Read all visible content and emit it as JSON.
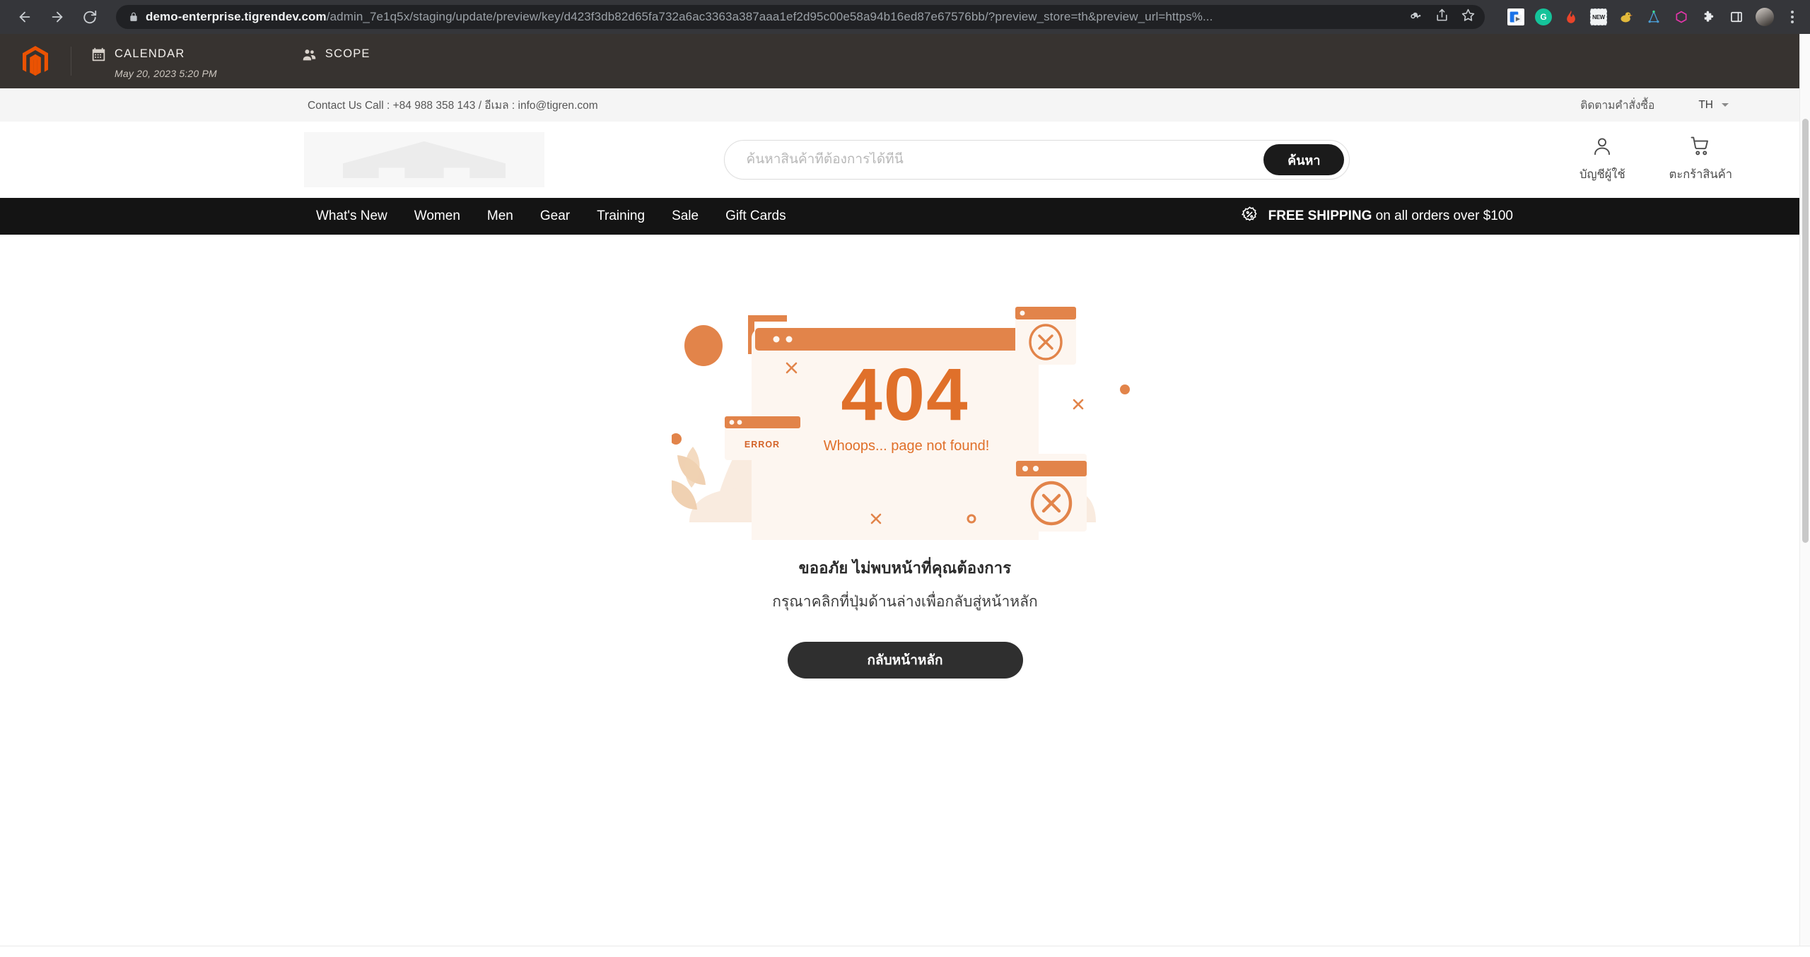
{
  "browser": {
    "back_label": "Back",
    "forward_label": "Forward",
    "reload_label": "Reload",
    "url_domain": "demo-enterprise.tigrendev.com",
    "url_path": "/admin_7e1q5x/staging/update/preview/key/d423f3db82d65fa732a6ac3363a387aaa1ef2d95c00e58a94b16ed87e67576bb/?preview_store=th&preview_url=https%...",
    "icons": {
      "lock": "lock-icon",
      "password_key": "key-icon",
      "share": "share-icon",
      "bookmark": "star-icon",
      "kebab": "more-vertical-icon"
    },
    "extensions": [
      {
        "name": "google-docs-extension",
        "glyph": "G",
        "color": "#1a73e8"
      },
      {
        "name": "grammarly-extension",
        "glyph": "G",
        "color": "#15c39a"
      },
      {
        "name": "fire-extension",
        "glyph": "▲",
        "color": "#e8442a"
      },
      {
        "name": "new-badge-extension",
        "glyph": "NEW",
        "color": "#f3f3f3"
      },
      {
        "name": "duck-extension",
        "glyph": "●",
        "color": "#e2b93b"
      },
      {
        "name": "network-extension",
        "glyph": "✳",
        "color": "#4b9cd3"
      },
      {
        "name": "graphql-extension",
        "glyph": "⬡",
        "color": "#e535ab"
      },
      {
        "name": "puzzle-extension",
        "glyph": "❖",
        "color": "#e8eaed"
      },
      {
        "name": "sidepanel-extension",
        "glyph": "▣",
        "color": "#e8eaed"
      }
    ]
  },
  "admin": {
    "logo_name": "magento-logo",
    "calendar": {
      "label": "CALENDAR",
      "date": "May 20, 2023 5:20 PM",
      "icon": "calendar-icon"
    },
    "scope": {
      "label": "SCOPE",
      "icon": "users-icon"
    }
  },
  "store": {
    "topbar": {
      "contact": "Contact Us Call : +84 988 358 143 / อีเมล : info@tigren.com",
      "track_order": "ติดตามคำสั่งซื้อ",
      "language": "TH"
    },
    "header": {
      "logo_name": "store-logo-placeholder",
      "search_placeholder": "ค้นหาสินค้าที่ต้องการได้ที่นี่",
      "search_value": "",
      "search_button": "ค้นหา",
      "account_label": "บัญชีผู้ใช้",
      "cart_label": "ตะกร้าสินค้า"
    },
    "nav": {
      "items": [
        {
          "label": "What's New",
          "name": "nav-item-whats-new"
        },
        {
          "label": "Women",
          "name": "nav-item-women"
        },
        {
          "label": "Men",
          "name": "nav-item-men"
        },
        {
          "label": "Gear",
          "name": "nav-item-gear"
        },
        {
          "label": "Training",
          "name": "nav-item-training"
        },
        {
          "label": "Sale",
          "name": "nav-item-sale"
        },
        {
          "label": "Gift Cards",
          "name": "nav-item-gift-cards"
        }
      ],
      "shipping_strong": "FREE SHIPPING",
      "shipping_rest": "on all orders over $100",
      "shipping_icon": "discount-badge-icon"
    }
  },
  "error_page": {
    "code": "404",
    "illustration_caption": "Whoops... page not found!",
    "error_tag": "ERROR",
    "heading": "ขออภัย ไม่พบหน้าที่คุณต้องการ",
    "subheading": "กรุณาคลิกที่ปุ่มด้านล่างเพื่อกลับสู่หน้าหลัก",
    "home_button": "กลับหน้าหลัก"
  },
  "colors": {
    "magento_orange": "#eb5202",
    "illustration_orange": "#e2844a",
    "illustration_tint": "#f7e7da",
    "nav_black": "#141414",
    "admin_bg": "#373330",
    "browser_bg": "#35363a"
  }
}
